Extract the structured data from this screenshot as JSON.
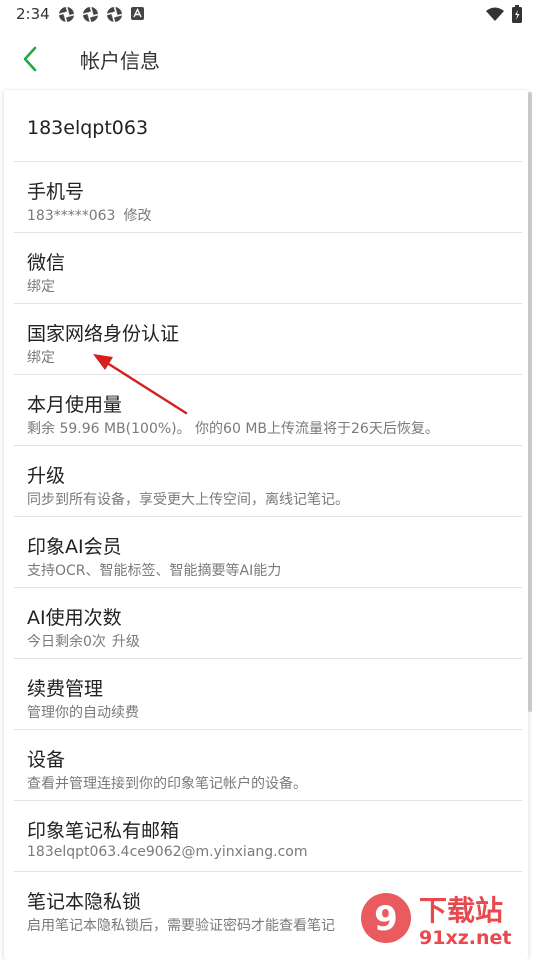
{
  "status_bar": {
    "time": "2:34"
  },
  "header": {
    "title": "帐户信息"
  },
  "account": {
    "username": "183elqpt063"
  },
  "rows": [
    {
      "title": "手机号",
      "subtitle": "183*****063",
      "action": "修改"
    },
    {
      "title": "微信",
      "subtitle": "绑定"
    },
    {
      "title": "国家网络身份认证",
      "subtitle": "绑定"
    },
    {
      "title": "本月使用量",
      "subtitle": "剩余 59.96 MB(100%)。 你的60 MB上传流量将于26天后恢复。"
    },
    {
      "title": "升级",
      "subtitle": "同步到所有设备，享受更大上传空间，离线记笔记。"
    },
    {
      "title": "印象AI会员",
      "subtitle": "支持OCR、智能标签、智能摘要等AI能力"
    },
    {
      "title": "AI使用次数",
      "subtitle": "今日剩余0次",
      "action": "升级"
    },
    {
      "title": "续费管理",
      "subtitle": "管理你的自动续费"
    },
    {
      "title": "设备",
      "subtitle": "查看并管理连接到你的印象笔记帐户的设备。"
    },
    {
      "title": "印象笔记私有邮箱",
      "subtitle": "183elqpt063.4ce9062@m.yinxiang.com"
    },
    {
      "title": "笔记本隐私锁",
      "subtitle": "启用笔记本隐私锁后，需要验证密码才能查看笔记"
    }
  ],
  "watermark": {
    "text1": "下载站",
    "text2": "91xz.net"
  },
  "colors": {
    "accent": "#1faa45",
    "annotation": "#d62020"
  }
}
